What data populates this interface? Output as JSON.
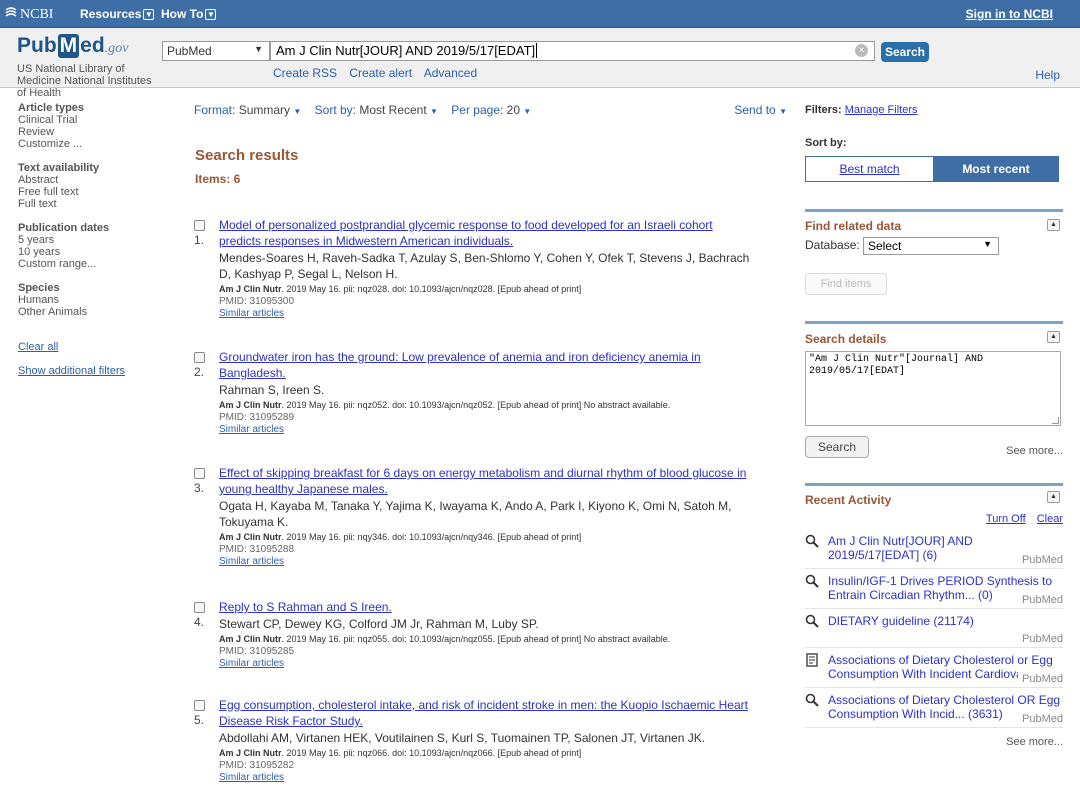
{
  "topbar": {
    "brand": "NCBI",
    "resources": "Resources",
    "howto": "How To",
    "signin": "Sign in to NCBI"
  },
  "header": {
    "logo_pub": "Pub",
    "logo_m": "M",
    "logo_ed": "ed",
    "logo_gov": ".gov",
    "nlm_text": "US National Library of Medicine National Institutes of Health",
    "db_selected": "PubMed",
    "query": "Am J Clin Nutr[JOUR] AND 2019/5/17[EDAT]",
    "search_label": "Search",
    "links": [
      "Create RSS",
      "Create alert",
      "Advanced"
    ],
    "help": "Help"
  },
  "sidebar": {
    "article_types": {
      "heading": "Article types",
      "items": [
        "Clinical Trial",
        "Review",
        "Customize ..."
      ]
    },
    "text_availability": {
      "heading": "Text availability",
      "items": [
        "Abstract",
        "Free full text",
        "Full text"
      ]
    },
    "publication_dates": {
      "heading": "Publication dates",
      "items": [
        "5 years",
        "10 years",
        "Custom range..."
      ]
    },
    "species": {
      "heading": "Species",
      "items": [
        "Humans",
        "Other Animals"
      ]
    },
    "clear_all": "Clear all",
    "show_filters": "Show additional filters"
  },
  "format_bar": {
    "format_label": "Format",
    "format_value": "Summary",
    "sort_label": "Sort by",
    "sort_value": "Most Recent",
    "per_page_label": "Per page",
    "per_page_value": "20",
    "send_to": "Send to"
  },
  "results": {
    "title": "Search results",
    "count_label": "Items: 6",
    "items": [
      {
        "num": "1.",
        "title_l1": "Model of personalized postprandial glycemic response to food developed for an Israeli cohort",
        "title_l2": "predicts responses in Midwestern American individuals.",
        "authors_l1": "Mendes-Soares H, Raveh-Sadka T, Azulay S, Ben-Shlomo Y, Cohen Y, Ofek T, Stevens J, Bachrach",
        "authors_l2": "D, Kashyap P, Segal L, Nelson H.",
        "journal": "Am J Clin Nutr",
        "cite": ". 2019 May 16. pii: nqz028. doi: 10.1093/ajcn/nqz028. [Epub ahead of print]",
        "pmid": "PMID: 31095300",
        "similar": "Similar articles"
      },
      {
        "num": "2.",
        "title_l1": "Groundwater iron has the ground: Low prevalence of anemia and iron deficiency anemia in",
        "title_l2": "Bangladesh.",
        "authors_l1": "Rahman S, Ireen S.",
        "authors_l2": "",
        "journal": "Am J Clin Nutr",
        "cite": ". 2019 May 16. pii: nqz052. doi: 10.1093/ajcn/nqz052. [Epub ahead of print] No abstract available.",
        "pmid": "PMID: 31095289",
        "similar": "Similar articles"
      },
      {
        "num": "3.",
        "title_l1": "Effect of skipping breakfast for 6 days on energy metabolism and diurnal rhythm of blood glucose in",
        "title_l2": "young healthy Japanese males.",
        "authors_l1": "Ogata H, Kayaba M, Tanaka Y, Yajima K, Iwayama K, Ando A, Park I, Kiyono K, Omi N, Satoh M,",
        "authors_l2": "Tokuyama K.",
        "journal": "Am J Clin Nutr",
        "cite": ". 2019 May 16. pii: nqy346. doi: 10.1093/ajcn/nqy346. [Epub ahead of print]",
        "pmid": "PMID: 31095288",
        "similar": "Similar articles"
      },
      {
        "num": "4.",
        "title_l1": "Reply to S Rahman and S Ireen.",
        "title_l2": "",
        "authors_l1": "Stewart CP, Dewey KG, Colford JM Jr, Rahman M, Luby SP.",
        "authors_l2": "",
        "journal": "Am J Clin Nutr",
        "cite": ". 2019 May 16. pii: nqz055. doi: 10.1093/ajcn/nqz055. [Epub ahead of print] No abstract available.",
        "pmid": "PMID: 31095285",
        "similar": "Similar articles"
      },
      {
        "num": "5.",
        "title_l1": "Egg consumption, cholesterol intake, and risk of incident stroke in men: the Kuopio Ischaemic Heart",
        "title_l2": "Disease Risk Factor Study.",
        "authors_l1": "Abdollahi AM, Virtanen HEK, Voutilainen S, Kurl S, Tuomainen TP, Salonen JT, Virtanen JK.",
        "authors_l2": "",
        "journal": "Am J Clin Nutr",
        "cite": ". 2019 May 16. pii: nqz066. doi: 10.1093/ajcn/nqz066. [Epub ahead of print]",
        "pmid": "PMID: 31095282",
        "similar": "Similar articles"
      }
    ]
  },
  "right": {
    "filters_label": "Filters:",
    "manage_filters": "Manage Filters",
    "sort_by": "Sort by:",
    "best_match": "Best match",
    "most_recent": "Most recent",
    "related": {
      "heading": "Find related data",
      "db_label": "Database:",
      "db_value": "Select",
      "find_items": "Find items"
    },
    "details": {
      "heading": "Search details",
      "text": "\"Am J Clin Nutr\"[Journal] AND\n2019/05/17[EDAT]",
      "search": "Search",
      "see_more": "See more..."
    },
    "activity": {
      "heading": "Recent Activity",
      "turn_off": "Turn Off",
      "clear": "Clear",
      "items": [
        {
          "l1": "Am J Clin Nutr[JOUR] AND",
          "l2": "2019/5/17[EDAT] (6)",
          "src": "PubMed",
          "icon": "search-icon"
        },
        {
          "l1": "Insulin/IGF-1 Drives PERIOD Synthesis to",
          "l2": "Entrain Circadian Rhythm... (0)",
          "src": "PubMed",
          "icon": "search-icon"
        },
        {
          "l1": "DIETARY guideline (21174)",
          "l2": "",
          "src": "PubMed",
          "icon": "search-icon"
        },
        {
          "l1": "Associations of Dietary Cholesterol or Egg",
          "l2": "Consumption With Incident Cardiova",
          "src": "PubMed",
          "icon": "document-icon"
        },
        {
          "l1": "Associations of Dietary Cholesterol OR Egg",
          "l2": "Consumption With Incid... (3631)",
          "src": "PubMed",
          "icon": "search-icon"
        }
      ],
      "see_more": "See more..."
    }
  },
  "colors": {
    "topbar": "#3f6ea6",
    "result_link": "#2b31c9",
    "heading_brown": "#985735"
  }
}
